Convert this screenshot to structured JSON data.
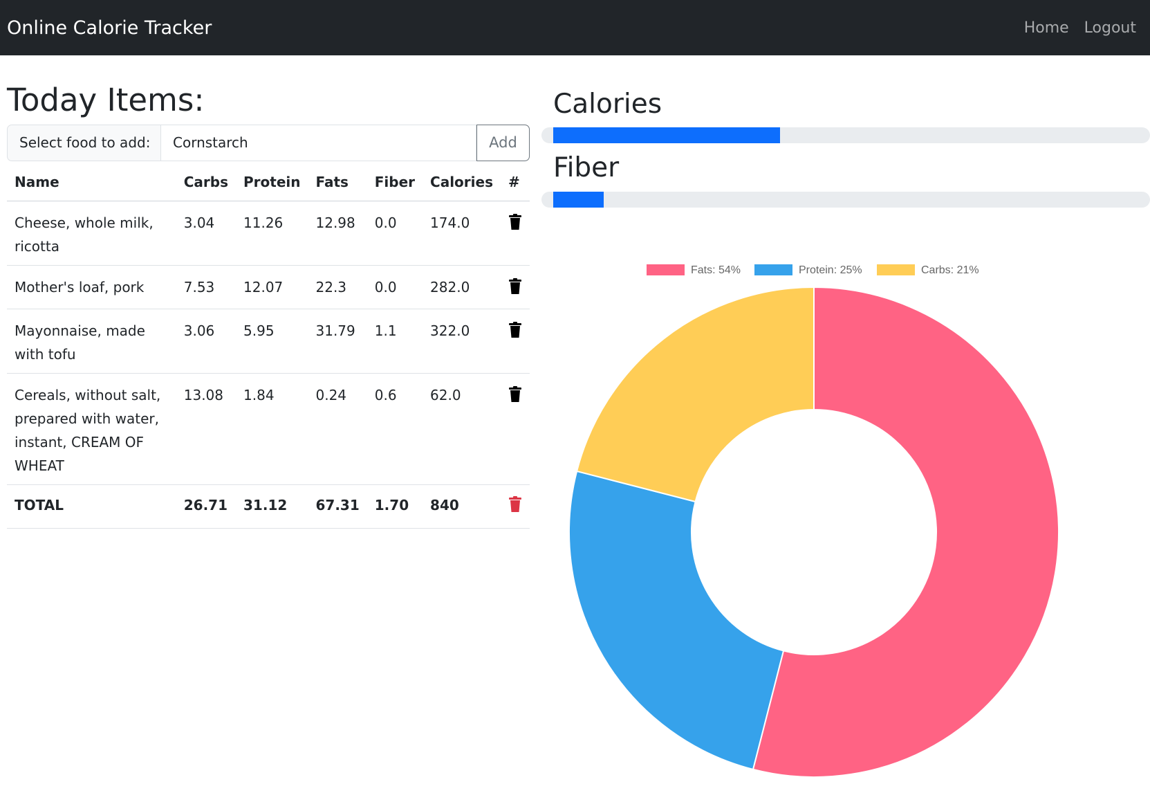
{
  "navbar": {
    "brand": "Online Calorie Tracker",
    "links": [
      "Home",
      "Logout"
    ]
  },
  "left": {
    "title": "Today Items:",
    "select_label": "Select food to add:",
    "selected_food": "Cornstarch",
    "add_label": "Add",
    "columns": [
      "Name",
      "Carbs",
      "Protein",
      "Fats",
      "Fiber",
      "Calories",
      "#"
    ],
    "rows": [
      {
        "name": "Cheese, whole milk, ricotta",
        "carbs": "3.04",
        "protein": "11.26",
        "fats": "12.98",
        "fiber": "0.0",
        "calories": "174.0"
      },
      {
        "name": "Mother's loaf, pork",
        "carbs": "7.53",
        "protein": "12.07",
        "fats": "22.3",
        "fiber": "0.0",
        "calories": "282.0"
      },
      {
        "name": "Mayonnaise, made with tofu",
        "carbs": "3.06",
        "protein": "5.95",
        "fats": "31.79",
        "fiber": "1.1",
        "calories": "322.0"
      },
      {
        "name": "Cereals, without salt, prepared with water, instant, CREAM OF WHEAT",
        "carbs": "13.08",
        "protein": "1.84",
        "fats": "0.24",
        "fiber": "0.6",
        "calories": "62.0"
      }
    ],
    "total": {
      "name": "TOTAL",
      "carbs": "26.71",
      "protein": "31.12",
      "fats": "67.31",
      "fiber": "1.70",
      "calories": "840"
    }
  },
  "right": {
    "calories_title": "Calories",
    "calories_progress": 0.38,
    "fiber_title": "Fiber",
    "fiber_progress": 0.085
  },
  "colors": {
    "navbar": "#212529",
    "progress": "#0d6efd",
    "fats": "#ff6384",
    "protein": "#36a2eb",
    "carbs": "#ffcd56",
    "trash_total": "#dc3545"
  },
  "chart_data": {
    "type": "pie",
    "legend_position": "top",
    "categories": [
      "Fats",
      "Protein",
      "Carbs"
    ],
    "values": [
      54,
      25,
      21
    ],
    "legend": [
      "Fats: 54%",
      "Protein: 25%",
      "Carbs: 21%"
    ],
    "colors": [
      "#ff6384",
      "#36a2eb",
      "#ffcd56"
    ]
  }
}
